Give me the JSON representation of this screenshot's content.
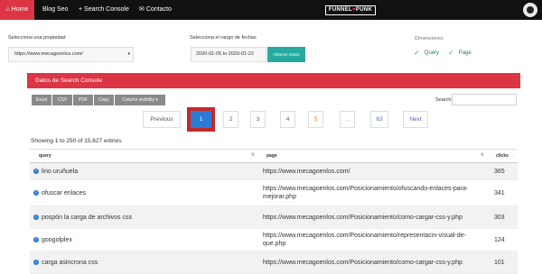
{
  "nav": {
    "home": "Home",
    "blog": "Blog Seo",
    "search_console": "+ Search Console",
    "contact": "Contacto",
    "brand_left": "FUNNEL",
    "brand_heart": "♥",
    "brand_right": "PUNK"
  },
  "filters": {
    "property_label": "Selecciona una propiedad",
    "property_value": "https://www.mecagoenlos.com/",
    "range_label": "Selecciona el rango de fechas",
    "range_value": "2020-01-05 to 2020-01-22",
    "fetch_button": "Obtener Datos",
    "dimensions_label": "Dimensiones",
    "dim_query": "Query",
    "dim_page": "Page"
  },
  "panel": {
    "title": "Datos de Search Console"
  },
  "toolbar": {
    "excel": "Excel",
    "csv": "CSV",
    "pdf": "PDF",
    "copy": "Copy",
    "colvis": "Column visibility ▾",
    "search_label": "Search:"
  },
  "pagination": {
    "prev": "Previous",
    "p1": "1",
    "p2": "2",
    "p3": "3",
    "p4": "4",
    "p5": "5",
    "ellipsis": "…",
    "last": "63",
    "next": "Next"
  },
  "showing": "Showing 1 to 250 of 15,627 entries",
  "table": {
    "headers": {
      "query": "query",
      "page": "page",
      "clicks": "clicks"
    },
    "rows": [
      {
        "query": "lino uruñuela",
        "page": "https://www.mecagoenlos.com/",
        "clicks": "365"
      },
      {
        "query": "ofuscar enlaces",
        "page": "https://www.mecagoenlos.com/Posicionamiento/ofuscando-enlaces-para-mejorar.php",
        "clicks": "341"
      },
      {
        "query": "pospón la carga de archivos css",
        "page": "https://www.mecagoenlos.com/Posicionamiento/como-cargar-css-y.php",
        "clicks": "303"
      },
      {
        "query": "googolplex",
        "page": "https://www.mecagoenlos.com/Posicionamiento/representacin-visual-de-que.php",
        "clicks": "124"
      },
      {
        "query": "carga asincrona css",
        "page": "https://www.mecagoenlos.com/Posicionamiento/como-cargar-css-y.php",
        "clicks": "101"
      }
    ]
  },
  "colors": {
    "accent_red": "#dc3545",
    "nav_bg": "#111111",
    "teal_button": "#25a9a0",
    "link_blue": "#2a7ad8"
  }
}
